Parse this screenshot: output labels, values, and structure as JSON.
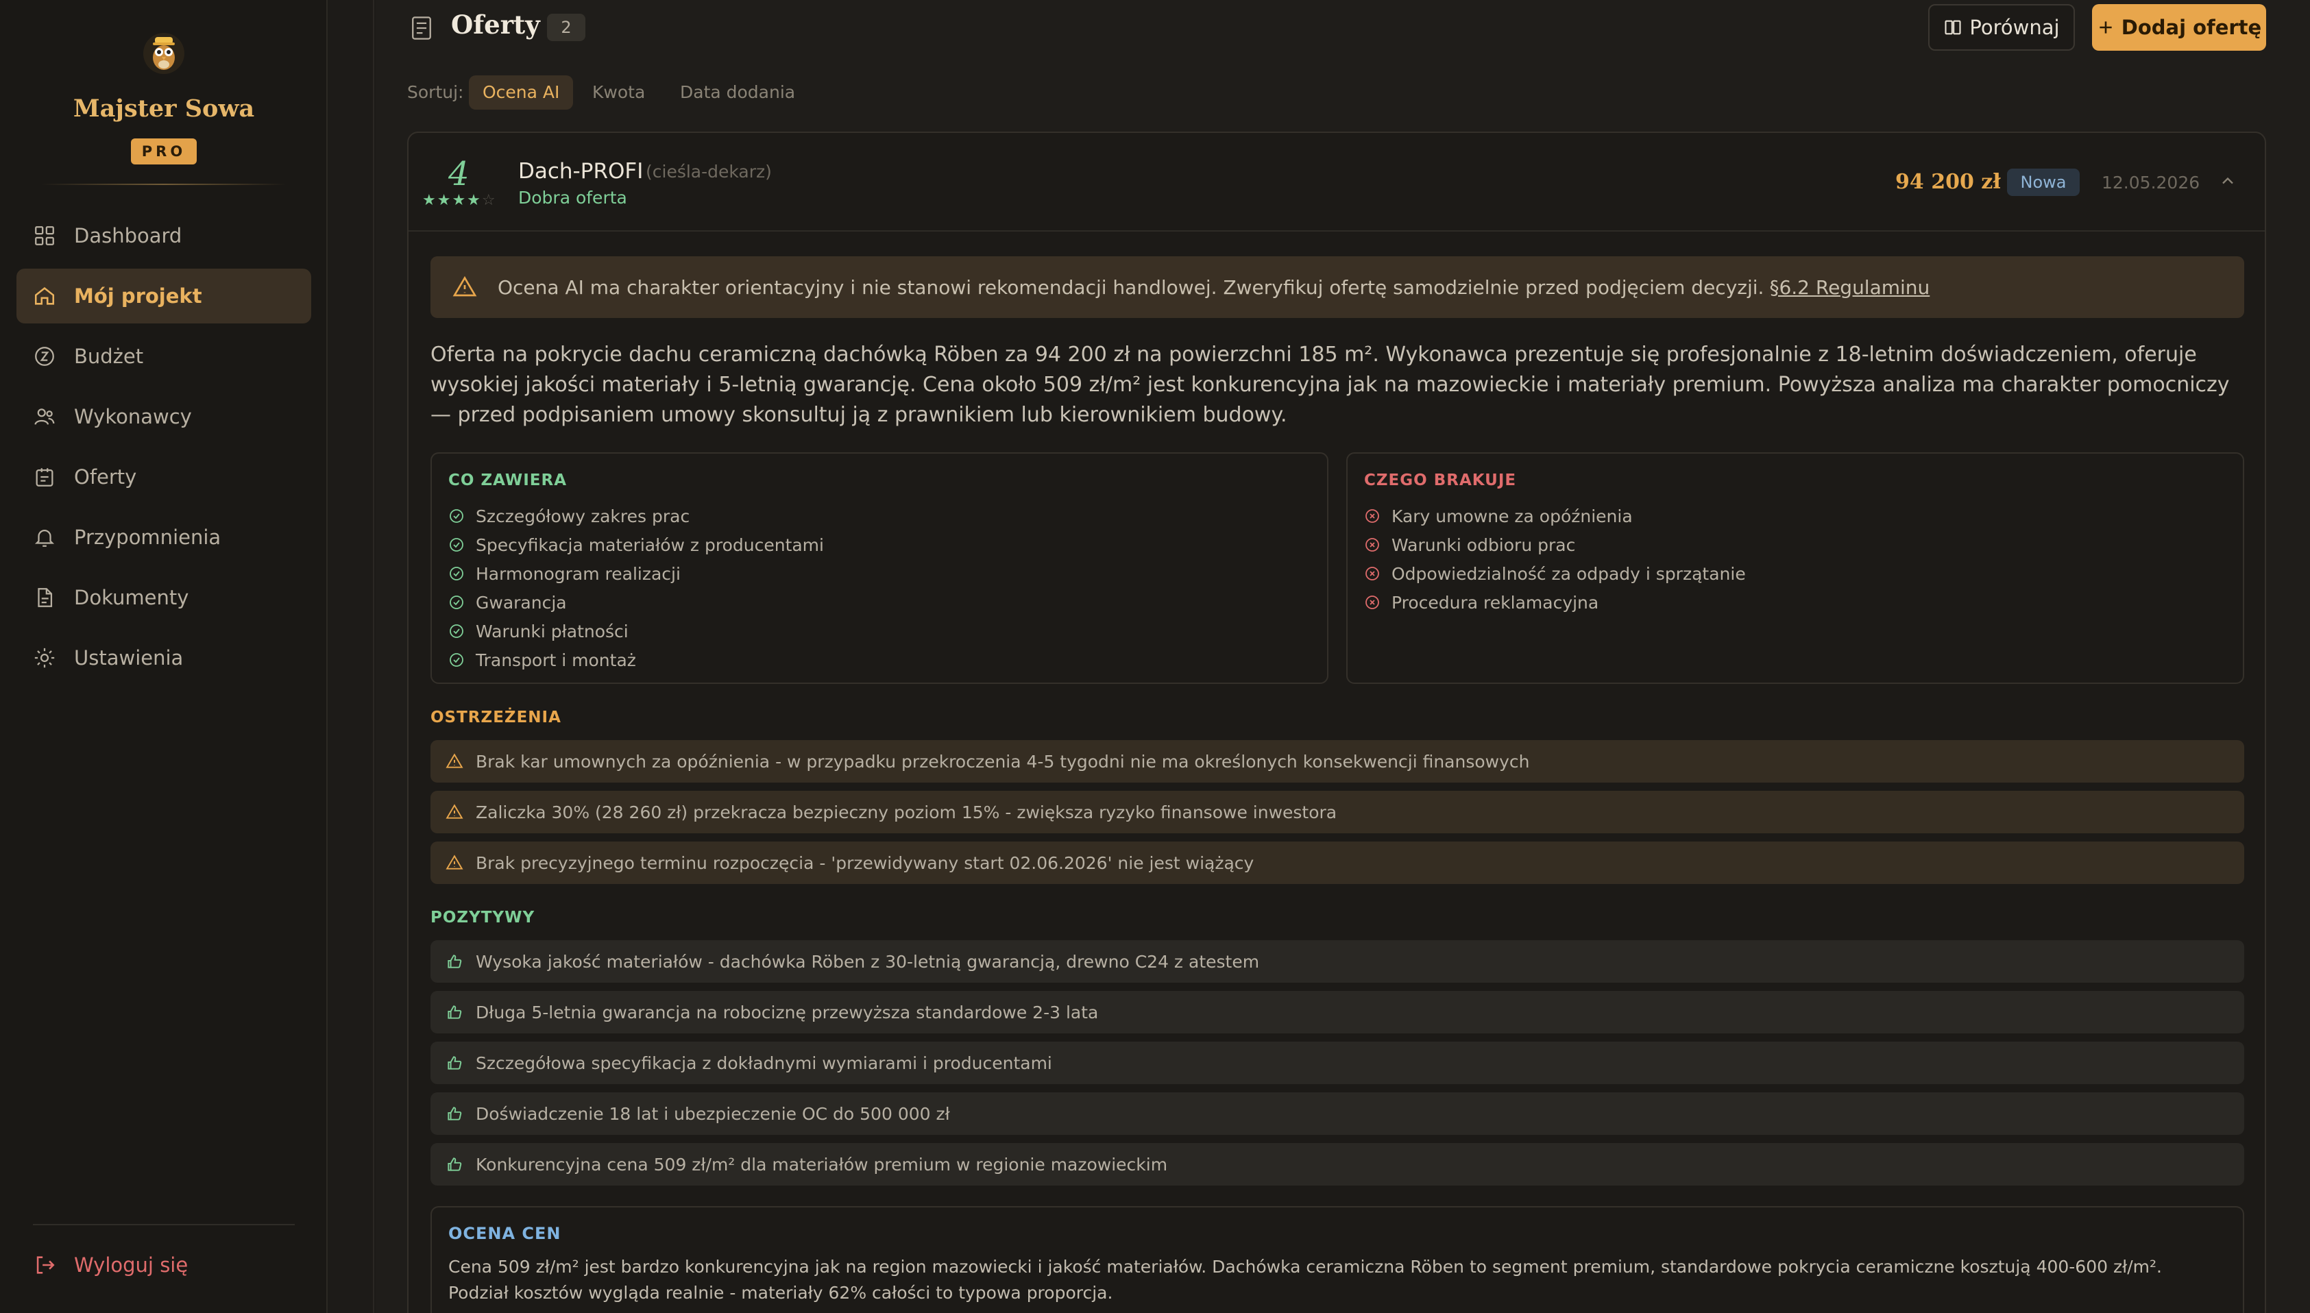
{
  "brand": {
    "name": "Majster Sowa",
    "badge": "PRO"
  },
  "sidebar": {
    "items": [
      {
        "label": "Dashboard",
        "icon": "grid-icon"
      },
      {
        "label": "Mój projekt",
        "icon": "home-icon"
      },
      {
        "label": "Budżet",
        "icon": "coin-icon"
      },
      {
        "label": "Wykonawcy",
        "icon": "users-icon"
      },
      {
        "label": "Oferty",
        "icon": "clipboard-icon"
      },
      {
        "label": "Przypomnienia",
        "icon": "bell-icon"
      },
      {
        "label": "Dokumenty",
        "icon": "document-icon"
      },
      {
        "label": "Ustawienia",
        "icon": "gear-icon"
      }
    ],
    "active_index": 1,
    "logout": "Wyloguj się"
  },
  "header": {
    "title": "Oferty",
    "count": "2",
    "compare_label": "Porównaj",
    "add_label": "Dodaj ofertę"
  },
  "sort": {
    "label": "Sortuj:",
    "options": [
      "Ocena AI",
      "Kwota",
      "Data dodania"
    ],
    "active": "Ocena AI"
  },
  "offer": {
    "score": "4",
    "stars": "★★★★",
    "stars_off": "☆",
    "rating": 4,
    "company": "Dach-PROFI",
    "trade": "(cieśla-dekarz)",
    "verdict": "Dobra oferta",
    "price": "94 200 zł",
    "status": "Nowa",
    "date": "12.05.2026",
    "disclaimer": "Ocena AI ma charakter orientacyjny i nie stanowi rekomendacji handlowej. Zweryfikuj ofertę samodzielnie przed podjęciem decyzji.",
    "disclaimer_link": "§6.2 Regulaminu",
    "summary": "Oferta na pokrycie dachu ceramiczną dachówką Röben za 94 200 zł na powierzchni 185 m². Wykonawca prezentuje się profesjonalnie z 18-letnim doświadczeniem, oferuje wysokiej jakości materiały i 5-letnią gwarancję. Cena około 509 zł/m² jest konkurencyjna jak na mazowieckie i materiały premium. Powyższa analiza ma charakter pomocniczy — przed podpisaniem umowy skonsultuj ją z prawnikiem lub kierownikiem budowy.",
    "includes_title": "CO ZAWIERA",
    "includes": [
      "Szczegółowy zakres prac",
      "Specyfikacja materiałów z producentami",
      "Harmonogram realizacji",
      "Gwarancja",
      "Warunki płatności",
      "Transport i montaż"
    ],
    "missing_title": "CZEGO BRAKUJE",
    "missing": [
      "Kary umowne za opóźnienia",
      "Warunki odbioru prac",
      "Odpowiedzialność za odpady i sprzątanie",
      "Procedura reklamacyjna"
    ],
    "warnings_title": "OSTRZEŻENIA",
    "warnings": [
      "Brak kar umownych za opóźnienia - w przypadku przekroczenia 4-5 tygodni nie ma określonych konsekwencji finansowych",
      "Zaliczka 30% (28 260 zł) przekracza bezpieczny poziom 15% - zwiększa ryzyko finansowe inwestora",
      "Brak precyzyjnego terminu rozpoczęcia - 'przewidywany start 02.06.2026' nie jest wiążący"
    ],
    "positives_title": "POZYTYWY",
    "positives": [
      "Wysoka jakość materiałów - dachówka Röben z 30-letnią gwarancją, drewno C24 z atestem",
      "Długa 5-letnia gwarancja na robociznę przewyższa standardowe 2-3 lata",
      "Szczegółowa specyfikacja z dokładnymi wymiarami i producentami",
      "Doświadczenie 18 lat i ubezpieczenie OC do 500 000 zł",
      "Konkurencyjna cena 509 zł/m² dla materiałów premium w regionie mazowieckim"
    ],
    "price_eval_title": "OCENA CEN",
    "price_eval": "Cena 509 zł/m² jest bardzo konkurencyjna jak na region mazowiecki i jakość materiałów. Dachówka ceramiczna Röben to segment premium, standardowe pokrycia ceramiczne kosztują 400-600 zł/m². Podział kosztów wygląda realnie - materiały 62% całości to typowa proporcja."
  },
  "colors": {
    "accent": "#e8a64c",
    "positive": "#7fcf98",
    "negative": "#e06c6c",
    "info": "#7fb3e0",
    "background": "#1f1d1a"
  }
}
